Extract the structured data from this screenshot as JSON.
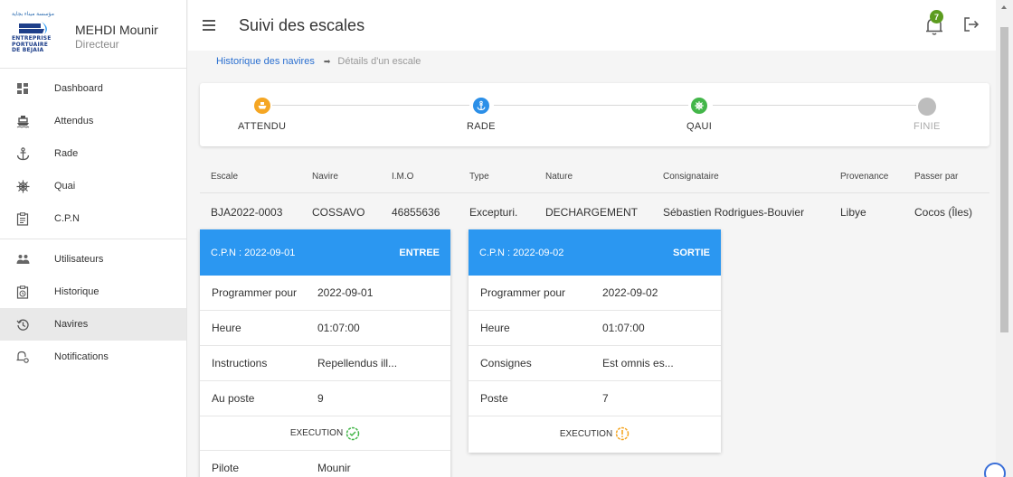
{
  "branding": {
    "arabic_text": "مؤسسة ميناء بجاية",
    "logo_lines": [
      "ENTREPRISE",
      "PORTUAIRE",
      "DE BEJAIA"
    ],
    "colors": {
      "brand_blue": "#1e3f8a",
      "accent_blue": "#2b97f1"
    }
  },
  "user": {
    "name": "MEHDI Mounir",
    "role": "Directeur"
  },
  "sidebar": {
    "items": [
      {
        "label": "Dashboard",
        "icon": "dashboard-icon"
      },
      {
        "label": "Attendus",
        "icon": "ship-icon"
      },
      {
        "label": "Rade",
        "icon": "anchor-icon"
      },
      {
        "label": "Quai",
        "icon": "ship-wheel-icon"
      },
      {
        "label": "C.P.N",
        "icon": "clipboard-icon"
      },
      {
        "label": "Utilisateurs",
        "icon": "users-icon"
      },
      {
        "label": "Historique",
        "icon": "history-clipboard-icon"
      },
      {
        "label": "Navires",
        "icon": "restore-icon",
        "active": true
      },
      {
        "label": "Notifications",
        "icon": "bell-settings-icon"
      }
    ]
  },
  "header": {
    "title": "Suivi des escales",
    "notification_count": "7"
  },
  "breadcrumb": {
    "link": "Historique des navires",
    "current": "Détails d'un escale"
  },
  "stepper": {
    "steps": [
      {
        "label": "ATTENDU",
        "color": "#f5a623",
        "icon": "boat-icon"
      },
      {
        "label": "RADE",
        "color": "#2b8fe8",
        "icon": "anchor-icon"
      },
      {
        "label": "QAUI",
        "color": "#43b649",
        "icon": "ship-wheel-icon"
      },
      {
        "label": "FINIE",
        "color": "#bdbdbd",
        "icon": "circle-icon",
        "disabled": true
      }
    ]
  },
  "table": {
    "headers": [
      "Escale",
      "Navire",
      "I.M.O",
      "Type",
      "Nature",
      "Consignataire",
      "Provenance",
      "Passer par"
    ],
    "row": [
      "BJA2022-0003",
      "COSSAVO",
      "46855636",
      "Excepturi.",
      "DECHARGEMENT",
      "Sébastien Rodrigues-Bouvier",
      "Libye",
      "Cocos (Îles)"
    ]
  },
  "cpn_entree": {
    "title": "C.P.N : 2022-09-01",
    "badge": "ENTREE",
    "rows": [
      {
        "key": "Programmer pour",
        "value": "2022-09-01"
      },
      {
        "key": "Heure",
        "value": "01:07:00"
      },
      {
        "key": "Instructions",
        "value": "Repellendus ill..."
      },
      {
        "key": "Au poste",
        "value": "9"
      }
    ],
    "execution": "EXECUTION",
    "execution_status": "done",
    "extra_row": {
      "key": "Pilote",
      "value": "Mounir"
    }
  },
  "cpn_sortie": {
    "title": "C.P.N : 2022-09-02",
    "badge": "SORTIE",
    "rows": [
      {
        "key": "Programmer pour",
        "value": "2022-09-02"
      },
      {
        "key": "Heure",
        "value": "01:07:00"
      },
      {
        "key": "Consignes",
        "value": "Est omnis es..."
      },
      {
        "key": "Poste",
        "value": "7"
      }
    ],
    "execution": "EXECUTION",
    "execution_status": "pending"
  }
}
